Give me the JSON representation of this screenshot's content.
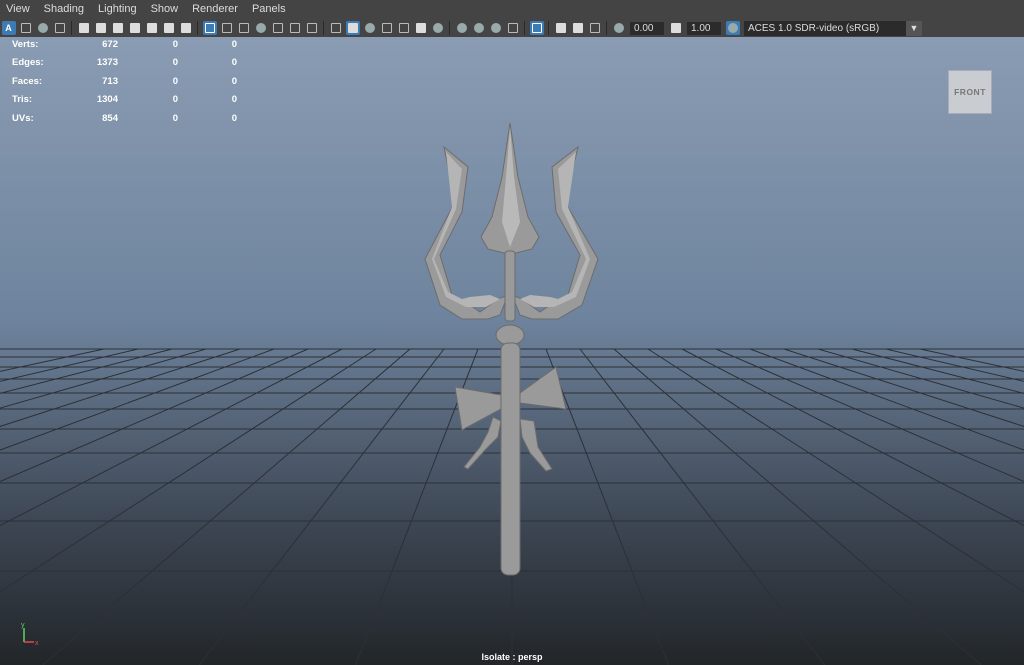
{
  "menu": [
    "View",
    "Shading",
    "Lighting",
    "Show",
    "Renderer",
    "Panels"
  ],
  "toolbar": {
    "select_badge": "A",
    "exposure": "0.00",
    "gamma": "1.00",
    "colorspace": "ACES 1.0 SDR-video (sRGB)"
  },
  "stats": [
    {
      "label": "Verts:",
      "v1": "672",
      "v2": "0",
      "v3": "0"
    },
    {
      "label": "Edges:",
      "v1": "1373",
      "v2": "0",
      "v3": "0"
    },
    {
      "label": "Faces:",
      "v1": "713",
      "v2": "0",
      "v3": "0"
    },
    {
      "label": "Tris:",
      "v1": "1304",
      "v2": "0",
      "v3": "0"
    },
    {
      "label": "UVs:",
      "v1": "854",
      "v2": "0",
      "v3": "0"
    }
  ],
  "viewcube_label": "FRONT",
  "status": "Isolate : persp",
  "axis": {
    "y": "y",
    "x": "x"
  },
  "colors": {
    "accent": "#3d7bb5",
    "viewport_top": "#8a9cb3",
    "viewport_bottom": "#222629",
    "mesh": "#9a9a9a"
  }
}
